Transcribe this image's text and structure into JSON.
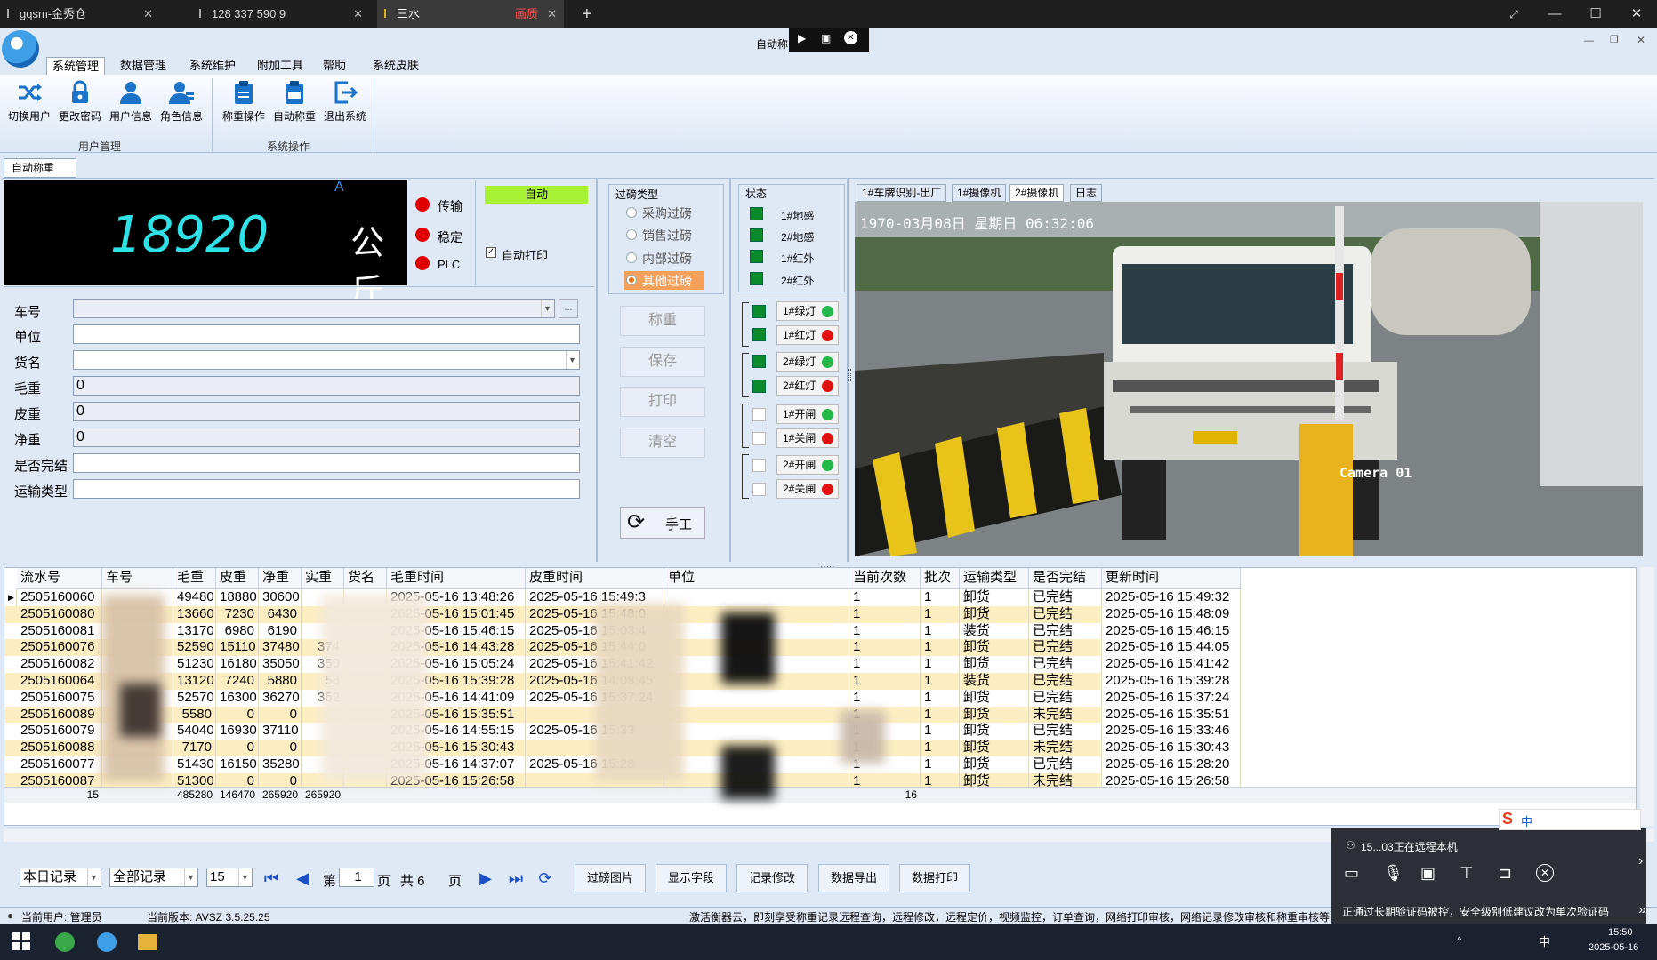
{
  "browser": {
    "tabs": [
      {
        "label": "gqsm-金秀仓"
      },
      {
        "label": "128 337 590 9"
      },
      {
        "label": "三水",
        "badge": "画质"
      }
    ],
    "new_tab": "+"
  },
  "app": {
    "title": "自动称",
    "menu_tabs": [
      "系统管理",
      "数据管理",
      "系统维护",
      "附加工具",
      "帮助",
      "系统皮肤"
    ],
    "ribbon": {
      "user_group": {
        "label": "用户管理",
        "buttons": [
          "切换用户",
          "更改密码",
          "用户信息",
          "角色信息"
        ]
      },
      "system_group": {
        "label": "系统操作",
        "buttons": [
          "称重操作",
          "自动称重",
          "退出系统"
        ]
      }
    },
    "doc_tab": "自动称重"
  },
  "scale": {
    "weight": "18920",
    "unit": "公斤",
    "marker": "A",
    "indicators": [
      "传输",
      "稳定",
      "PLC"
    ],
    "mode": "自动",
    "auto_print_label": "自动打印",
    "auto_print_checked": true
  },
  "form": {
    "labels": [
      "车号",
      "单位",
      "货名",
      "毛重",
      "皮重",
      "净重",
      "是否完结",
      "运输类型"
    ],
    "values": [
      "",
      "",
      "",
      "0",
      "0",
      "0",
      "",
      ""
    ],
    "ellipsis": "..."
  },
  "pass_type": {
    "title": "过磅类型",
    "options": [
      "采购过磅",
      "销售过磅",
      "内部过磅",
      "其他过磅"
    ],
    "selected": 3
  },
  "actions": [
    "称重",
    "保存",
    "打印",
    "清空"
  ],
  "manual_button": "手工",
  "status": {
    "title": "状态",
    "sensors": [
      "1#地感",
      "2#地感",
      "1#红外",
      "2#红外"
    ],
    "lights": [
      {
        "label": "1#绿灯",
        "color": "#22b84a",
        "on": true
      },
      {
        "label": "1#红灯",
        "color": "#e11111",
        "on": true
      },
      {
        "label": "2#绿灯",
        "color": "#22b84a",
        "on": true
      },
      {
        "label": "2#红灯",
        "color": "#e11111",
        "on": true
      },
      {
        "label": "1#开闸",
        "color": "#22b84a",
        "on": false
      },
      {
        "label": "1#关闸",
        "color": "#e11111",
        "on": false
      },
      {
        "label": "2#开闸",
        "color": "#22b84a",
        "on": false
      },
      {
        "label": "2#关闸",
        "color": "#e11111",
        "on": false
      }
    ]
  },
  "camera": {
    "tabs": [
      "1#车牌识别-出厂",
      "1#摄像机",
      "2#摄像机",
      "日志"
    ],
    "active": 2,
    "osd_time": "1970-03月08日 星期日 06:32:06",
    "osd_name": "Camera 01"
  },
  "grid": {
    "headers": [
      "流水号",
      "车号",
      "毛重",
      "皮重",
      "净重",
      "实重",
      "货名",
      "毛重时间",
      "皮重时间",
      "单位",
      "当前次数",
      "批次",
      "运输类型",
      "是否完结",
      "更新时间"
    ],
    "rows": [
      [
        "2505160060",
        "",
        "49480",
        "18880",
        "30600",
        "",
        "",
        "2025-05-16 13:48:26",
        "2025-05-16 15:49:3",
        "",
        "1",
        "1",
        "卸货",
        "已完结",
        "2025-05-16 15:49:32"
      ],
      [
        "2505160080",
        "",
        "13660",
        "7230",
        "6430",
        "",
        "",
        "2025-05-16 15:01:45",
        "2025-05-16 15:48:0",
        "",
        "1",
        "1",
        "卸货",
        "已完结",
        "2025-05-16 15:48:09"
      ],
      [
        "2505160081",
        "",
        "13170",
        "6980",
        "6190",
        "",
        "",
        "2025-05-16 15:46:15",
        "2025-05-16 15:03:4",
        "",
        "1",
        "1",
        "装货",
        "已完结",
        "2025-05-16 15:46:15"
      ],
      [
        "2505160076",
        "",
        "52590",
        "15110",
        "37480",
        "374",
        "",
        "2025-05-16 14:43:28",
        "2025-05-16 15:44:0",
        "",
        "1",
        "1",
        "卸货",
        "已完结",
        "2025-05-16 15:44:05"
      ],
      [
        "2505160082",
        "",
        "51230",
        "16180",
        "35050",
        "350",
        "",
        "2025-05-16 15:05:24",
        "2025-05-16 15:41:42",
        "",
        "1",
        "1",
        "卸货",
        "已完结",
        "2025-05-16 15:41:42"
      ],
      [
        "2505160064",
        "",
        "13120",
        "7240",
        "5880",
        "58",
        "",
        "2025-05-16 15:39:28",
        "2025-05-16 14:08:45",
        "",
        "1",
        "1",
        "装货",
        "已完结",
        "2025-05-16 15:39:28"
      ],
      [
        "2505160075",
        "",
        "52570",
        "16300",
        "36270",
        "362",
        "",
        "2025-05-16 14:41:09",
        "2025-05-16 15:37:24",
        "",
        "1",
        "1",
        "卸货",
        "已完结",
        "2025-05-16 15:37:24"
      ],
      [
        "2505160089",
        "",
        "5580",
        "0",
        "0",
        "",
        "",
        "2025-05-16 15:35:51",
        "",
        "",
        "1",
        "1",
        "卸货",
        "未完结",
        "2025-05-16 15:35:51"
      ],
      [
        "2505160079",
        "",
        "54040",
        "16930",
        "37110",
        "",
        "",
        "2025-05-16 14:55:15",
        "2025-05-16 15:33",
        "",
        "1",
        "1",
        "卸货",
        "已完结",
        "2025-05-16 15:33:46"
      ],
      [
        "2505160088",
        "",
        "7170",
        "0",
        "0",
        "",
        "",
        "2025-05-16 15:30:43",
        "",
        "",
        "1",
        "1",
        "卸货",
        "未完结",
        "2025-05-16 15:30:43"
      ],
      [
        "2505160077",
        "",
        "51430",
        "16150",
        "35280",
        "",
        "",
        "2025-05-16 14:37:07",
        "2025-05-16 15:28",
        "",
        "1",
        "1",
        "卸货",
        "已完结",
        "2025-05-16 15:28:20"
      ],
      [
        "2505160087",
        "",
        "51300",
        "0",
        "0",
        "",
        "",
        "2025-05-16 15:26:58",
        "",
        "",
        "1",
        "1",
        "卸货",
        "未完结",
        "2025-05-16 15:26:58"
      ]
    ],
    "footer": {
      "count": "15",
      "gross": "485280",
      "tare": "146470",
      "net": "265920",
      "real": "265920",
      "times": "16"
    }
  },
  "pager": {
    "range": "本日记录",
    "filter": "全部记录",
    "page_size": "15",
    "page_prefix": "第",
    "page": "1",
    "page_suffix": "页",
    "total": "共 6",
    "total_suffix": "页",
    "buttons": [
      "过磅图片",
      "显示字段",
      "记录修改",
      "数据导出",
      "数据打印"
    ]
  },
  "statusbar": {
    "user": "当前用户: 管理员",
    "version": "当前版本: AVSZ 3.5.25.25",
    "notice": "激活衡器云，即刻享受称重记录远程查询，远程修改，远程定价，视频监控，订单查询，网络打印审核，网络记录修改审核和称重审核等功能"
  },
  "remote": {
    "title": "15...03正在远程本机",
    "warning": "正通过长期验证码被控，安全级别低建议改为单次验证码"
  },
  "taskbar": {
    "time": "15:50",
    "date": "2025-05-16",
    "ime": "中"
  }
}
